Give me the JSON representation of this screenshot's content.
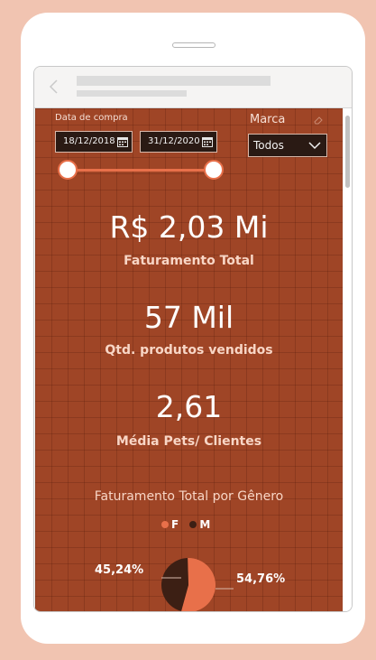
{
  "filters": {
    "date_label": "Data de compra",
    "start_date": "18/12/2018",
    "end_date": "31/12/2020",
    "brand_label": "Marca",
    "brand_value": "Todos"
  },
  "kpis": [
    {
      "value": "R$ 2,03 Mi",
      "label": "Faturamento Total"
    },
    {
      "value": "57 Mil",
      "label": "Qtd. produtos vendidos"
    },
    {
      "value": "2,61",
      "label": "Média Pets/ Clientes"
    }
  ],
  "colors": {
    "background": "#9f4526",
    "accent": "#e8704a",
    "dark": "#3c1f14"
  },
  "icons": [
    "back-arrow-icon",
    "calendar-icon",
    "eraser-icon",
    "chevron-down-icon"
  ],
  "chart_data": {
    "type": "pie",
    "title": "Faturamento Total por Gênero",
    "categories": [
      "F",
      "M"
    ],
    "values": [
      54.76,
      45.24
    ],
    "value_labels": [
      "54,76%",
      "45,24%"
    ],
    "colors": [
      "#e8704a",
      "#3c1f14"
    ],
    "legend_position": "top"
  }
}
